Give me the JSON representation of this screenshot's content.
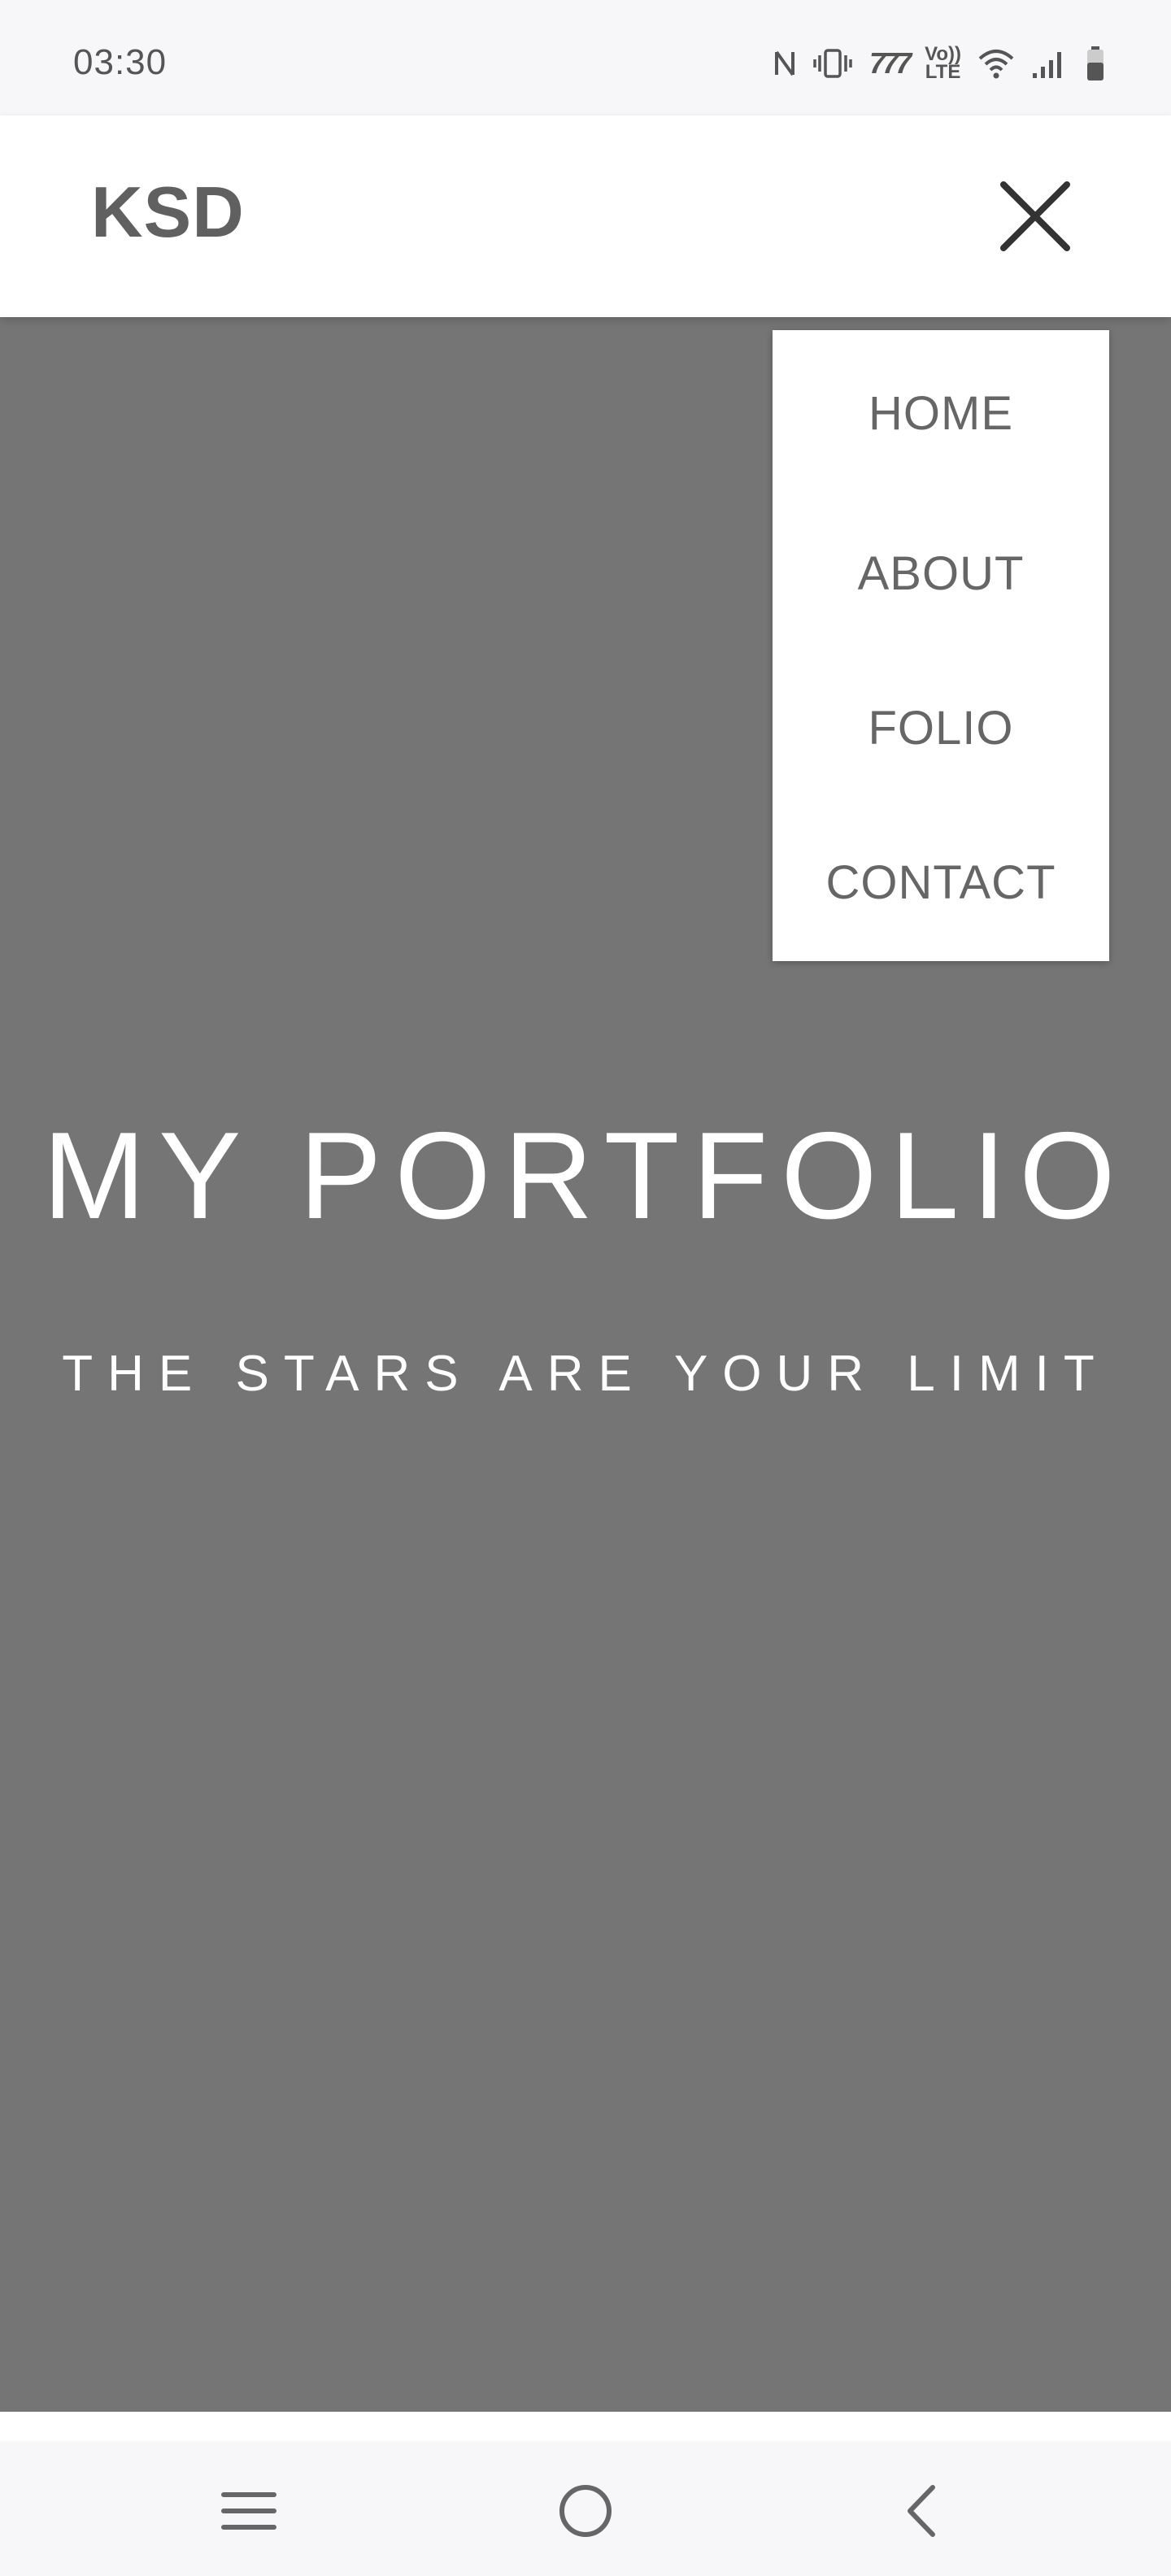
{
  "status_bar": {
    "time": "03:30",
    "volte_label": "Vo))\nLTE",
    "speed_label": "777",
    "icons": [
      "nfc-icon",
      "vibrate-icon",
      "speed-icon",
      "volte-icon",
      "wifi-icon",
      "signal-icon",
      "battery-icon"
    ]
  },
  "navbar": {
    "brand": "KSD",
    "close_icon": "close-icon"
  },
  "menu": {
    "items": [
      {
        "label": "HOME"
      },
      {
        "label": "ABOUT"
      },
      {
        "label": "FOLIO"
      },
      {
        "label": "CONTACT"
      }
    ]
  },
  "hero": {
    "title": "MY PORTFOLIO",
    "subtitle": "THE STARS ARE YOUR LIMIT",
    "background_color": "#757575"
  },
  "system_nav": {
    "icons": [
      "menu-icon",
      "home-icon",
      "back-icon"
    ]
  }
}
